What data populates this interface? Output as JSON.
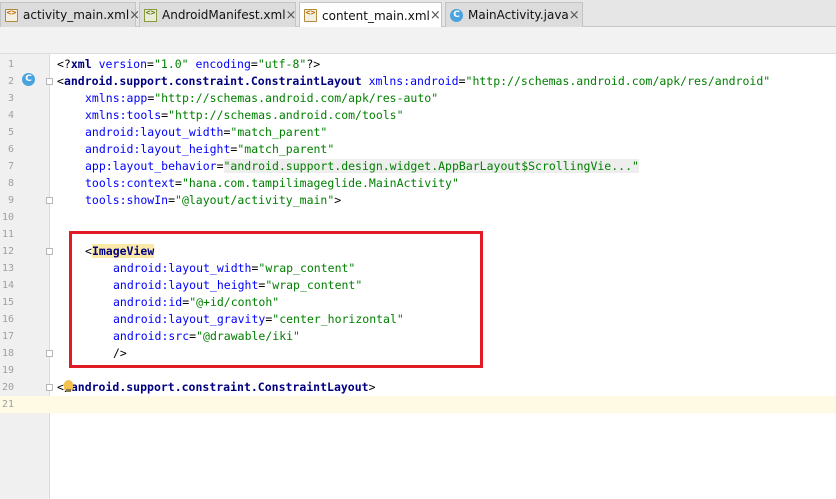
{
  "tabs": [
    {
      "label": "activity_main.xml",
      "icon": "xml-file-icon",
      "active": false
    },
    {
      "label": "AndroidManifest.xml",
      "icon": "manifest-file-icon",
      "active": false
    },
    {
      "label": "content_main.xml",
      "icon": "xml-file-icon",
      "active": true
    },
    {
      "label": "MainActivity.java",
      "icon": "java-class-icon",
      "active": false
    }
  ],
  "tab_close_glyph": "×",
  "class_badge": "C",
  "editor": {
    "line_numbers": [
      "1",
      "2",
      "3",
      "4",
      "5",
      "6",
      "7",
      "8",
      "9",
      "10",
      "11",
      "12",
      "13",
      "14",
      "15",
      "16",
      "17",
      "18",
      "19",
      "20",
      "21"
    ],
    "lines": {
      "l1": {
        "open": "<?",
        "tag": "xml",
        "a1": " version",
        "e1": "=",
        "v1": "\"1.0\"",
        "a2": " encoding",
        "e2": "=",
        "v2": "\"utf-8\"",
        "close": "?>"
      },
      "l2": {
        "open": "<",
        "tag": "android.support.constraint.ConstraintLayout",
        "attr": " xmlns:android",
        "eq": "=",
        "val": "\"http://schemas.android.com/apk/res/android\""
      },
      "l3": {
        "attr": "xmlns:app",
        "eq": "=",
        "val": "\"http://schemas.android.com/apk/res-auto\""
      },
      "l4": {
        "attr": "xmlns:tools",
        "eq": "=",
        "val": "\"http://schemas.android.com/tools\""
      },
      "l5": {
        "attr": "android:layout_width",
        "eq": "=",
        "val": "\"match_parent\""
      },
      "l6": {
        "attr": "android:layout_height",
        "eq": "=",
        "val": "\"match_parent\""
      },
      "l7": {
        "attr": "app:layout_behavior",
        "eq": "=",
        "val": "\"android.support.design.widget.AppBarLayout$ScrollingVie...\""
      },
      "l8": {
        "attr": "tools:context",
        "eq": "=",
        "val": "\"hana.com.tampilimageglide.MainActivity\""
      },
      "l9": {
        "attr": "tools:showIn",
        "eq": "=",
        "val": "\"@layout/activity_main\"",
        "close": ">"
      },
      "l12": {
        "open": "<",
        "tag": "ImageView"
      },
      "l13": {
        "attr": "android:layout_width",
        "eq": "=",
        "val": "\"wrap_content\""
      },
      "l14": {
        "attr": "android:layout_height",
        "eq": "=",
        "val": "\"wrap_content\""
      },
      "l15": {
        "attr": "android:id",
        "eq": "=",
        "val": "\"@+id/contoh\""
      },
      "l16": {
        "attr": "android:layout_gravity",
        "eq": "=",
        "val": "\"center_horizontal\""
      },
      "l17": {
        "attr": "android:src",
        "eq": "=",
        "val": "\"@drawable/iki\""
      },
      "l18": {
        "text": "/>"
      },
      "l20": {
        "open": "<",
        "close_tag": "/android.support.constraint.ConstraintLayout",
        "close": ">"
      }
    }
  },
  "colors": {
    "annotation_box": "#e01b24",
    "xml_tag": "#000080",
    "xml_attr": "#0000ff",
    "xml_value": "#008000",
    "caret_line": "#fffae3"
  }
}
